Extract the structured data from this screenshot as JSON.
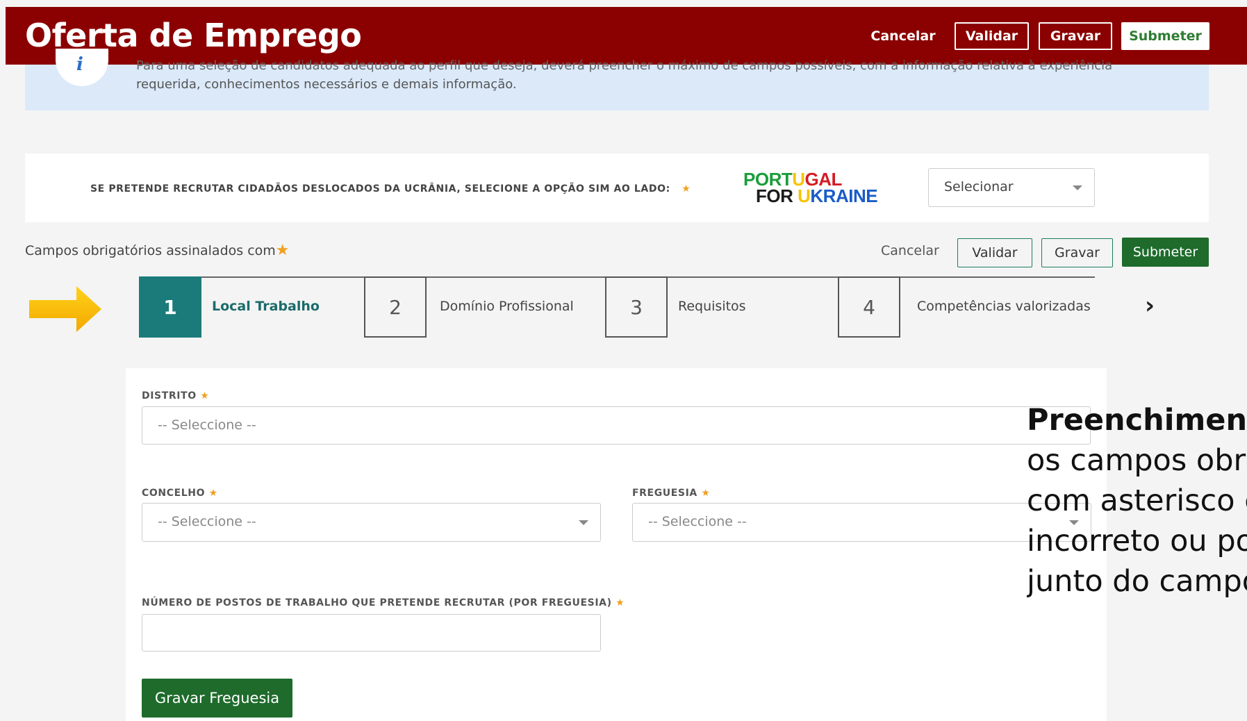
{
  "header": {
    "title": "Oferta de Emprego",
    "cancel_label": "Cancelar",
    "validate_label": "Validar",
    "save_label": "Gravar",
    "submit_label": "Submeter"
  },
  "info_banner": {
    "line1": "Para uma seleção de candidatos adequada ao perfil que deseja, deverá preencher o máximo de campos possíveis, com a informação relativa à experiência",
    "line2": "requerida, conhecimentos necessários e demais informação."
  },
  "ukraine": {
    "label": "SE PRETENDE RECRUTAR CIDADÃOS DESLOCADOS DA UCRÂNIA, SELECIONE A OPÇÃO SIM AO LADO:",
    "logo_line1_a": "PORT",
    "logo_line1_b": "U",
    "logo_line1_c": "GAL",
    "logo_line2_a": "FOR ",
    "logo_line2_b": "U",
    "logo_line2_c": "KRAINE",
    "select_value": "Selecionar"
  },
  "mandatory": {
    "note": "Campos obrigatórios assinalados com",
    "cancel_label": "Cancelar",
    "validate_label": "Validar",
    "save_label": "Gravar",
    "submit_label": "Submeter"
  },
  "steps": [
    {
      "number": "1",
      "label": "Local Trabalho",
      "active": true
    },
    {
      "number": "2",
      "label": "Domínio Profissional",
      "active": false
    },
    {
      "number": "3",
      "label": "Requisitos",
      "active": false
    },
    {
      "number": "4",
      "label": "Competências valorizadas",
      "active": false
    }
  ],
  "form": {
    "distrito_label": "DISTRITO",
    "distrito_placeholder": "-- Seleccione --",
    "concelho_label": "CONCELHO",
    "concelho_placeholder": "-- Seleccione --",
    "freguesia_label": "FREGUESIA",
    "freguesia_placeholder": "-- Seleccione --",
    "postos_label": "NÚMERO DE POSTOS DE TRABALHO QUE PRETENDE RECRUTAR (POR FREGUESIA)",
    "postos_value": "",
    "save_parish_label": "Gravar Freguesia"
  },
  "overlay": {
    "title": "Preenchimento",
    "line1": "os campos obri",
    "line2": "com asterisco e",
    "line3": "incorreto ou po",
    "line4": "junto do campo"
  },
  "icons": {
    "info": "info-icon",
    "arrow": "arrow-right-icon",
    "next": "chevron-right-icon",
    "required": "star-icon",
    "dropdown": "caret-down-icon"
  },
  "colors": {
    "header_bg": "#8b0000",
    "primary_green": "#1e6b2c",
    "step_active": "#1b7b7b",
    "required_star": "#f0a020",
    "info_bg": "#dbe9f9"
  }
}
